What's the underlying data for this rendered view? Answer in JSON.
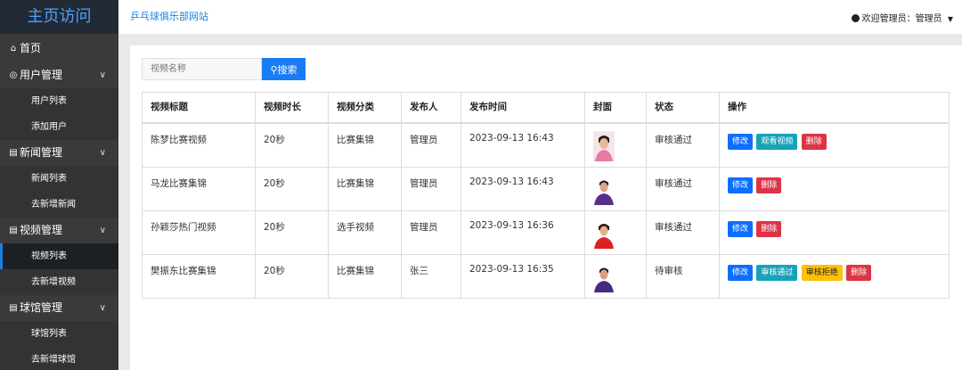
{
  "sidebar": {
    "brand": "主页访问",
    "home": "首页",
    "groups": [
      {
        "label": "用户管理",
        "subs": [
          "用户列表",
          "添加用户"
        ]
      },
      {
        "label": "新闻管理",
        "subs": [
          "新闻列表",
          "去新增新闻"
        ]
      },
      {
        "label": "视频管理",
        "subs": [
          "视频列表",
          "去新增视频"
        ]
      },
      {
        "label": "球馆管理",
        "subs": [
          "球馆列表",
          "去新增球馆"
        ]
      }
    ]
  },
  "topbar": {
    "site_name": "乒乓球俱乐部网站",
    "user": "欢迎管理员：管理员"
  },
  "search": {
    "placeholder": "视频名称",
    "button": "搜索"
  },
  "table": {
    "headers": [
      "视频标题",
      "视频时长",
      "视频分类",
      "发布人",
      "发布时间",
      "封面",
      "状态",
      "操作"
    ],
    "rows": [
      {
        "title": "陈梦比赛视频",
        "duration": "20秒",
        "category": "比赛集锦",
        "publisher": "管理员",
        "time": "2023-09-13 16:43",
        "status": "审核通过",
        "actions": [
          "修改",
          "观看视频",
          "删除"
        ]
      },
      {
        "title": "马龙比赛集锦",
        "duration": "20秒",
        "category": "比赛集锦",
        "publisher": "管理员",
        "time": "2023-09-13 16:43",
        "status": "审核通过",
        "actions": [
          "修改",
          "删除"
        ]
      },
      {
        "title": "孙颖莎热门视频",
        "duration": "20秒",
        "category": "选手视频",
        "publisher": "管理员",
        "time": "2023-09-13 16:36",
        "status": "审核通过",
        "actions": [
          "修改",
          "删除"
        ]
      },
      {
        "title": "樊振东比赛集锦",
        "duration": "20秒",
        "category": "比赛集锦",
        "publisher": "张三",
        "time": "2023-09-13 16:35",
        "status": "待审核",
        "actions": [
          "修改",
          "审核通过",
          "审核拒绝",
          "删除"
        ]
      }
    ]
  },
  "colors": {
    "primary": "#0d6efd",
    "info": "#17a2b8",
    "danger": "#dc3545",
    "warning": "#ffc107",
    "sidebar_bg": "#3a3a3a",
    "brand_bg": "#222a35"
  }
}
